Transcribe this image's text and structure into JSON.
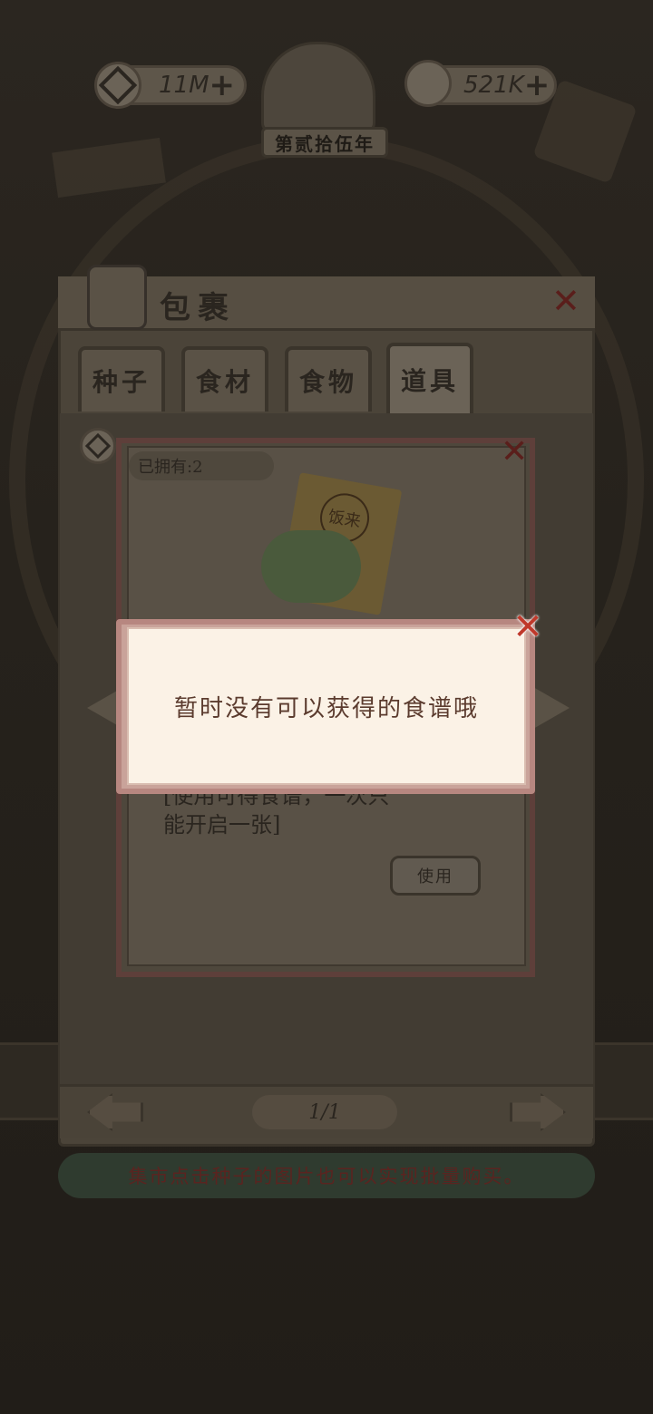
{
  "hud": {
    "coins": "11M",
    "water": "521K",
    "year": "第贰拾伍年",
    "plus": "+"
  },
  "bag": {
    "title": "包裹",
    "close": "✕",
    "tabs": [
      {
        "label": "种子"
      },
      {
        "label": "食材"
      },
      {
        "label": "食物"
      },
      {
        "label": "道具"
      }
    ],
    "page": "1/1",
    "tip": "集市点击种子的图片也可以实现批量购买。"
  },
  "item_card": {
    "owned": "已拥有:2",
    "ticket_text": "饭来",
    "desc_line1": "[使用可得食谱，一次只",
    "desc_line2": "能开启一张]",
    "use_label": "使用",
    "close": "✕"
  },
  "dialog": {
    "message": "暂时没有可以获得的食谱哦",
    "close": "✕"
  }
}
